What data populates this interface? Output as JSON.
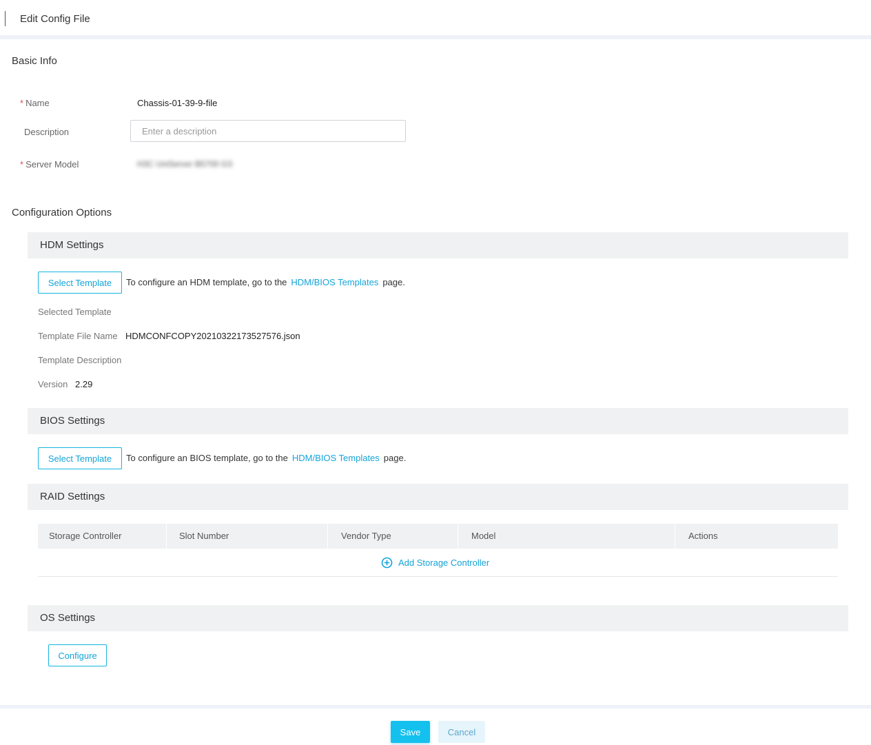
{
  "header": {
    "title": "Edit Config File"
  },
  "basic_info": {
    "title": "Basic Info",
    "name_label": "Name",
    "name_value": "Chassis-01-39-9-file",
    "description_label": "Description",
    "description_placeholder": "Enter a description",
    "description_value": "",
    "server_model_label": "Server Model",
    "server_model_value": "H3C UniServer B5700 G3"
  },
  "config_options": {
    "title": "Configuration Options",
    "hdm": {
      "title": "HDM Settings",
      "select_button": "Select Template",
      "hint_prefix": "To configure an HDM template, go to the",
      "hint_link": "HDM/BIOS Templates",
      "hint_suffix": "page.",
      "selected_template_label": "Selected Template",
      "template_file_name_label": "Template File Name",
      "template_file_name_value": "HDMCONFCOPY20210322173527576.json",
      "template_description_label": "Template Description",
      "version_label": "Version",
      "version_value": "2.29"
    },
    "bios": {
      "title": "BIOS Settings",
      "select_button": "Select Template",
      "hint_prefix": "To configure an BIOS template, go to the",
      "hint_link": "HDM/BIOS Templates",
      "hint_suffix": "page."
    },
    "raid": {
      "title": "RAID Settings",
      "columns": [
        "Storage Controller",
        "Slot Number",
        "Vendor Type",
        "Model",
        "Actions"
      ],
      "add_button": "Add Storage Controller"
    },
    "os": {
      "title": "OS Settings",
      "configure_button": "Configure"
    }
  },
  "footer": {
    "save_label": "Save",
    "cancel_label": "Cancel"
  },
  "colors": {
    "accent": "#14b4e0",
    "required": "#e84a4a",
    "panel_bg": "#f0f1f2"
  },
  "icons": {
    "add": "plus-circle-icon"
  }
}
